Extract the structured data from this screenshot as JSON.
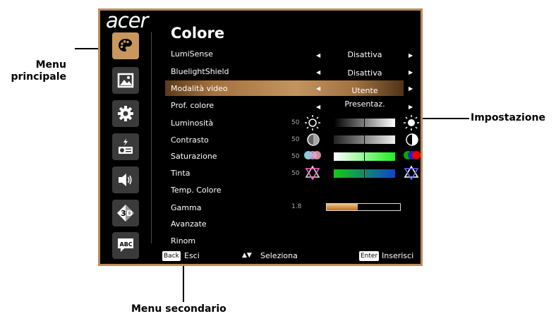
{
  "callouts": {
    "left_line1": "Menu",
    "left_line2": "principale",
    "right": "Impostazione",
    "bottom": "Menu secondario"
  },
  "osd": {
    "brand": "acer",
    "title": "Colore",
    "side_menu": [
      {
        "icon": "palette-icon",
        "active": true
      },
      {
        "icon": "image-icon",
        "active": false
      },
      {
        "icon": "gear-icon",
        "active": false
      },
      {
        "icon": "projector-management-icon",
        "active": false
      },
      {
        "icon": "speaker-icon",
        "active": false
      },
      {
        "icon": "3d-icon",
        "active": false
      },
      {
        "icon": "language-abc-icon",
        "active": false
      }
    ],
    "rows": {
      "lumisense": {
        "label": "LumiSense",
        "value": "Disattiva"
      },
      "bluelight": {
        "label": "BluelightShield",
        "value": "Disattiva"
      },
      "mode": {
        "label": "Modalità video",
        "value": "Utente",
        "selected": true
      },
      "prof": {
        "label": "Prof. colore",
        "value": "Presentaz."
      },
      "lum": {
        "label": "Luminosità",
        "value": "50",
        "level": 0.5
      },
      "contr": {
        "label": "Contrasto",
        "value": "50",
        "level": 0.5
      },
      "sat": {
        "label": "Saturazione",
        "value": "50",
        "level": 0.5
      },
      "tint": {
        "label": "Tinta",
        "value": "50",
        "level": 0.5
      },
      "temp": {
        "label": "Temp. Colore"
      },
      "gamma": {
        "label": "Gamma",
        "value": "1.8",
        "level": 0.42
      },
      "adv": {
        "label": "Avanzate"
      },
      "reset": {
        "label": "Rinom"
      }
    },
    "footer": {
      "back_key": "Back",
      "back_label": "Esci",
      "nav_label": "Seleziona",
      "enter_key": "Enter",
      "enter_label": "Inserisci"
    },
    "colors": {
      "frame": "#b98d5e",
      "active_item": "#c9975d",
      "highlight": "#c4945e"
    }
  }
}
